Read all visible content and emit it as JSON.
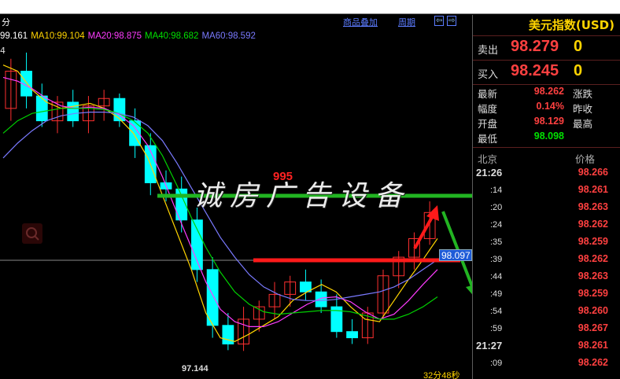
{
  "toolbar": {
    "period_short": "分",
    "overlay_label": "商品叠加",
    "cycle_label": "周期",
    "arrow_left": "⇦",
    "arrow_right": "⇨"
  },
  "ma_legend": [
    {
      "label": "99.161",
      "color": "#ffffff"
    },
    {
      "label": "MA10:99.104",
      "color": "#ffd400"
    },
    {
      "label": "MA20:98.875",
      "color": "#ff3cff"
    },
    {
      "label": "MA40:98.682",
      "color": "#00e000"
    },
    {
      "label": "MA60:98.592",
      "color": "#7a7aff"
    }
  ],
  "axis": {
    "top_fragment": "4",
    "low_value": "97.144",
    "current_price_tag": "98.097",
    "countdown": "32分48秒"
  },
  "watermark": {
    "text": "诚房广告设备",
    "overlay_number": "995"
  },
  "panel": {
    "title": "美元指数(USD)",
    "sell_label": "卖出",
    "sell_value": "98.279",
    "sell_qty": "0",
    "buy_label": "买入",
    "buy_value": "98.245",
    "buy_qty": "0",
    "stats": [
      {
        "label": "最新",
        "value": "98.262",
        "color": "#ff4040",
        "right": "涨跌"
      },
      {
        "label": "幅度",
        "value": "0.14%",
        "color": "#ff4040",
        "right": "昨收"
      },
      {
        "label": "开盘",
        "value": "98.129",
        "color": "#ff4040",
        "right": "最高"
      },
      {
        "label": "最低",
        "value": "98.098",
        "color": "#00e000",
        "right": ""
      }
    ],
    "ticks_head_left": "北京",
    "ticks_head_right": "价格",
    "ticks": [
      {
        "time": "21:26",
        "full": true,
        "price": "98.266"
      },
      {
        "time": ":14",
        "full": false,
        "price": "98.261"
      },
      {
        "time": ":20",
        "full": false,
        "price": "98.263"
      },
      {
        "time": ":24",
        "full": false,
        "price": "98.262"
      },
      {
        "time": ":35",
        "full": false,
        "price": "98.259"
      },
      {
        "time": ":39",
        "full": false,
        "price": "98.262"
      },
      {
        "time": ":44",
        "full": false,
        "price": "98.263"
      },
      {
        "time": ":49",
        "full": false,
        "price": "98.259"
      },
      {
        "time": ":54",
        "full": false,
        "price": "98.260"
      },
      {
        "time": ":59",
        "full": false,
        "price": "98.267"
      },
      {
        "time": "21:27",
        "full": true,
        "price": "98.261"
      },
      {
        "time": ":09",
        "full": false,
        "price": "98.262"
      }
    ]
  },
  "chart_data": {
    "type": "line",
    "title": "",
    "xlabel": "",
    "ylabel": "",
    "ylim": [
      97.0,
      99.6
    ],
    "series": [
      {
        "name": "MA10",
        "values": [
          99.45,
          99.4,
          99.25,
          99.15,
          99.1,
          99.12,
          99.14,
          99.1,
          99.02,
          98.9,
          98.7,
          98.4,
          98.1,
          97.8,
          97.45,
          97.25,
          97.22,
          97.28,
          97.35,
          97.42,
          97.55,
          97.62,
          97.68,
          97.62,
          97.5,
          97.4,
          97.38,
          97.55,
          97.72,
          97.88,
          98.05
        ]
      },
      {
        "name": "MA20",
        "values": [
          99.35,
          99.32,
          99.26,
          99.18,
          99.12,
          99.1,
          99.11,
          99.1,
          99.05,
          98.96,
          98.8,
          98.55,
          98.26,
          97.98,
          97.7,
          97.48,
          97.38,
          97.34,
          97.34,
          97.38,
          97.45,
          97.52,
          97.57,
          97.58,
          97.54,
          97.46,
          97.4,
          97.44,
          97.55,
          97.68,
          97.8
        ]
      },
      {
        "name": "MA40",
        "values": [
          98.9,
          99.0,
          99.06,
          99.08,
          99.1,
          99.1,
          99.1,
          99.09,
          99.06,
          99.0,
          98.9,
          98.72,
          98.48,
          98.22,
          97.98,
          97.78,
          97.62,
          97.52,
          97.46,
          97.44,
          97.45,
          97.46,
          97.47,
          97.47,
          97.46,
          97.43,
          97.4,
          97.4,
          97.44,
          97.5,
          97.58
        ]
      },
      {
        "name": "MA60",
        "values": [
          98.7,
          98.82,
          98.92,
          99.0,
          99.04,
          99.06,
          99.07,
          99.07,
          99.06,
          99.03,
          98.96,
          98.84,
          98.66,
          98.46,
          98.26,
          98.06,
          97.9,
          97.76,
          97.66,
          97.6,
          97.56,
          97.55,
          97.55,
          97.56,
          97.58,
          97.6,
          97.62,
          97.66,
          97.72,
          97.8,
          97.88
        ]
      }
    ],
    "candles": [
      {
        "o": 99.1,
        "h": 99.5,
        "l": 99.0,
        "c": 99.4
      },
      {
        "o": 99.4,
        "h": 99.55,
        "l": 99.1,
        "c": 99.2
      },
      {
        "o": 99.2,
        "h": 99.3,
        "l": 98.95,
        "c": 99.0
      },
      {
        "o": 99.0,
        "h": 99.2,
        "l": 98.9,
        "c": 99.15
      },
      {
        "o": 99.15,
        "h": 99.25,
        "l": 98.95,
        "c": 99.0
      },
      {
        "o": 99.0,
        "h": 99.2,
        "l": 98.9,
        "c": 99.12
      },
      {
        "o": 99.12,
        "h": 99.25,
        "l": 99.0,
        "c": 99.18
      },
      {
        "o": 99.18,
        "h": 99.22,
        "l": 98.95,
        "c": 99.0
      },
      {
        "o": 99.0,
        "h": 99.1,
        "l": 98.7,
        "c": 98.8
      },
      {
        "o": 98.8,
        "h": 98.9,
        "l": 98.4,
        "c": 98.5
      },
      {
        "o": 98.5,
        "h": 98.6,
        "l": 98.35,
        "c": 98.45
      },
      {
        "o": 98.45,
        "h": 98.55,
        "l": 98.1,
        "c": 98.2
      },
      {
        "o": 98.2,
        "h": 98.3,
        "l": 97.7,
        "c": 97.8
      },
      {
        "o": 97.8,
        "h": 97.9,
        "l": 97.25,
        "c": 97.35
      },
      {
        "o": 97.35,
        "h": 97.45,
        "l": 97.15,
        "c": 97.2
      },
      {
        "o": 97.2,
        "h": 97.5,
        "l": 97.144,
        "c": 97.4
      },
      {
        "o": 97.4,
        "h": 97.55,
        "l": 97.3,
        "c": 97.5
      },
      {
        "o": 97.5,
        "h": 97.7,
        "l": 97.4,
        "c": 97.6
      },
      {
        "o": 97.6,
        "h": 97.75,
        "l": 97.5,
        "c": 97.7
      },
      {
        "o": 97.7,
        "h": 97.8,
        "l": 97.55,
        "c": 97.62
      },
      {
        "o": 97.62,
        "h": 97.72,
        "l": 97.45,
        "c": 97.5
      },
      {
        "o": 97.5,
        "h": 97.6,
        "l": 97.25,
        "c": 97.3
      },
      {
        "o": 97.3,
        "h": 97.4,
        "l": 97.2,
        "c": 97.25
      },
      {
        "o": 97.25,
        "h": 97.5,
        "l": 97.2,
        "c": 97.45
      },
      {
        "o": 97.45,
        "h": 97.8,
        "l": 97.4,
        "c": 97.75
      },
      {
        "o": 97.75,
        "h": 97.95,
        "l": 97.65,
        "c": 97.9
      },
      {
        "o": 97.9,
        "h": 98.1,
        "l": 97.8,
        "c": 98.05
      },
      {
        "o": 98.05,
        "h": 98.35,
        "l": 98.0,
        "c": 98.26
      }
    ]
  }
}
